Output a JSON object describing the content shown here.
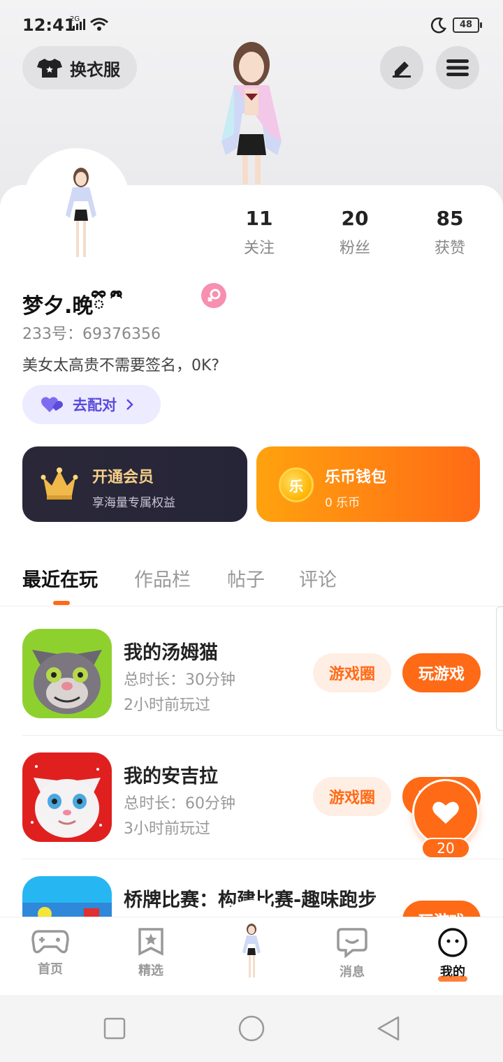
{
  "status": {
    "time": "12:41",
    "network": "2G",
    "battery": "48"
  },
  "header": {
    "outfit_label": "换衣服"
  },
  "profile": {
    "stats": [
      {
        "num": "11",
        "label": "关注"
      },
      {
        "num": "20",
        "label": "粉丝"
      },
      {
        "num": "85",
        "label": "获赞"
      }
    ],
    "nickname": "梦夕.晚ྀི ྀི",
    "id_line": "233号：69376356",
    "bio": "美女太高贵不需要签名，0K?",
    "match_label": "去配对"
  },
  "vip": {
    "title": "开通会员",
    "sub": "享海量专属权益"
  },
  "wallet": {
    "coin_glyph": "乐",
    "title": "乐币钱包",
    "sub": "0 乐币"
  },
  "tabs": [
    "最近在玩",
    "作品栏",
    "帖子",
    "评论"
  ],
  "games": [
    {
      "name": "我的汤姆猫",
      "time": "总时长：30分钟",
      "ago": "2小时前玩过",
      "circle_label": "游戏圈",
      "play_label": "玩游戏"
    },
    {
      "name": "我的安吉拉",
      "time": "总时长：60分钟",
      "ago": "3小时前玩过",
      "circle_label": "游戏圈",
      "play_label": "玩游戏"
    },
    {
      "name": "桥牌比赛：构建比赛-趣味跑步",
      "time": "",
      "ago": "",
      "circle_label": "",
      "play_label": "玩游戏"
    }
  ],
  "float_like": {
    "count": "20"
  },
  "bottom_nav": [
    {
      "label": "首页",
      "icon": "gamepad-icon"
    },
    {
      "label": "精选",
      "icon": "star-bookmark-icon"
    },
    {
      "label": "",
      "icon": "character-avatar"
    },
    {
      "label": "消息",
      "icon": "chat-icon"
    },
    {
      "label": "我的",
      "icon": "smiley-icon"
    }
  ],
  "colors": {
    "accent": "#ff6a16",
    "vip_gold": "#f5cf8a",
    "match_purple": "#5a4bdc"
  }
}
